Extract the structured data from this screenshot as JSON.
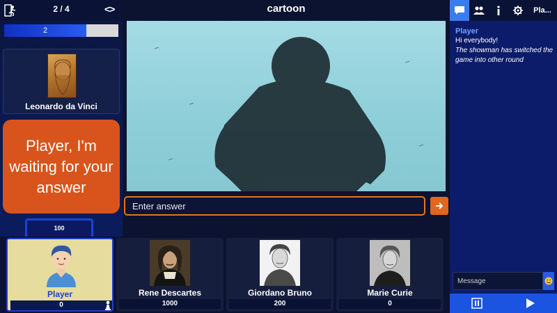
{
  "top_bar": {
    "round_counter": "2 / 4",
    "nav_arrows": "<>"
  },
  "progress": {
    "label": "2",
    "fraction": 0.72
  },
  "showman": {
    "name": "Leonardo da Vinci",
    "portrait_icon": "leonardo-portrait"
  },
  "speech_bubble": {
    "text": "Player, I'm waiting for your answer"
  },
  "timer": {
    "value": "100"
  },
  "question": {
    "theme": "cartoon",
    "image_icon": "gorilla-silhouette-image"
  },
  "answer": {
    "placeholder": "Enter answer",
    "send_icon": "arrow-right-icon"
  },
  "right_panel": {
    "tabs": [
      "chat-icon",
      "people-icon",
      "info-icon",
      "gear-icon"
    ],
    "more_label": "Pla...",
    "chat": {
      "author": "Player",
      "message": "Hi everybody!",
      "system_message": "The showman has switched the game into other round"
    },
    "message_placeholder": "Message",
    "emoji_icon": "smiley-icon",
    "controls": [
      "pause-icon",
      "play-icon"
    ]
  },
  "players": [
    {
      "name": "Player",
      "score": "0",
      "is_me": true,
      "avatar": "cartoon-man-avatar"
    },
    {
      "name": "Rene Descartes",
      "score": "1000",
      "avatar": "descartes-portrait"
    },
    {
      "name": "Giordano Bruno",
      "score": "200",
      "avatar": "bruno-portrait"
    },
    {
      "name": "Marie Curie",
      "score": "0",
      "avatar": "curie-portrait"
    }
  ],
  "colors": {
    "accent_orange": "#e2661c",
    "accent_blue": "#1f3fd0",
    "background": "#0c1330"
  }
}
